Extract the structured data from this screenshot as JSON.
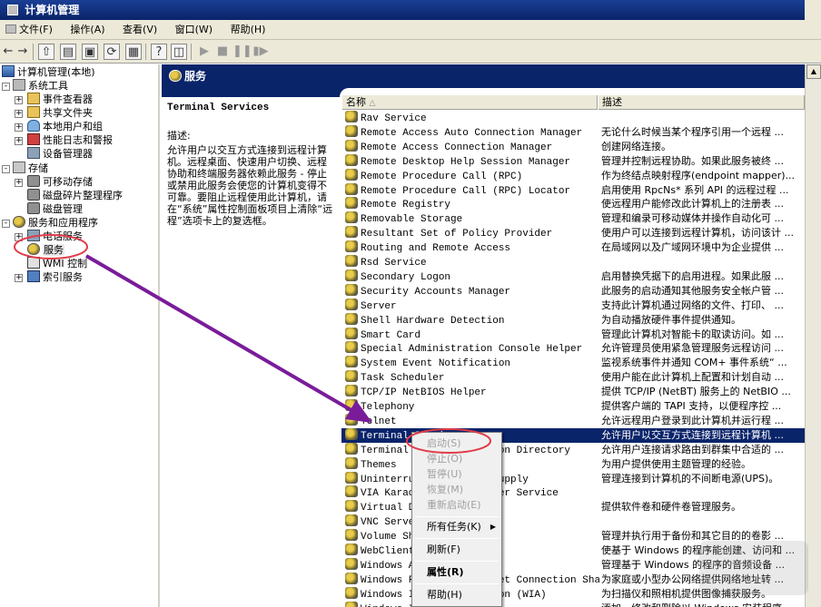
{
  "window": {
    "title": "计算机管理"
  },
  "menu": [
    "文件(F)",
    "操作(A)",
    "查看(V)",
    "窗口(W)",
    "帮助(H)"
  ],
  "tree": {
    "root": "计算机管理(本地)",
    "system_tools": "系统工具",
    "event_viewer": "事件查看器",
    "shared_folders": "共享文件夹",
    "local_users": "本地用户和组",
    "perf_logs": "性能日志和警报",
    "device_manager": "设备管理器",
    "storage": "存储",
    "removable_storage": "可移动存储",
    "defrag": "磁盘碎片整理程序",
    "disk_mgmt": "磁盘管理",
    "services_apps": "服务和应用程序",
    "telephony": "电话服务",
    "services": "服务",
    "wmi": "WMI 控制",
    "indexing": "索引服务"
  },
  "pane": {
    "header": "服务",
    "selected_service": "Terminal Services",
    "desc_label": "描述:",
    "desc_text": "允许用户以交互方式连接到远程计算机。远程桌面、快速用户切换、远程协助和终端服务器依赖此服务 - 停止或禁用此服务会使您的计算机变得不可靠。要阻止远程使用此计算机，请在“系统”属性控制面板项目上清除“远程”选项卡上的复选框。"
  },
  "list": {
    "col_name": "名称",
    "col_desc": "描述",
    "rows": [
      {
        "name": "Rav Service",
        "desc": ""
      },
      {
        "name": "Remote Access Auto Connection Manager",
        "desc": "无论什么时候当某个程序引用一个远程 ..."
      },
      {
        "name": "Remote Access Connection Manager",
        "desc": "创建网络连接。"
      },
      {
        "name": "Remote Desktop Help Session Manager",
        "desc": "管理并控制远程协助。如果此服务被终 ..."
      },
      {
        "name": "Remote Procedure Call (RPC)",
        "desc": "作为终结点映射程序(endpoint mapper)..."
      },
      {
        "name": "Remote Procedure Call (RPC) Locator",
        "desc": "启用使用 RpcNs* 系列 API 的远程过程 ..."
      },
      {
        "name": "Remote Registry",
        "desc": "使远程用户能修改此计算机上的注册表 ..."
      },
      {
        "name": "Removable Storage",
        "desc": "管理和编录可移动媒体并操作自动化可 ..."
      },
      {
        "name": "Resultant Set of Policy Provider",
        "desc": "使用户可以连接到远程计算机，访问该计 ..."
      },
      {
        "name": "Routing and Remote Access",
        "desc": "在局域网以及广域网环境中为企业提供 ..."
      },
      {
        "name": "Rsd Service",
        "desc": ""
      },
      {
        "name": "Secondary Logon",
        "desc": "启用替换凭据下的启用进程。如果此服 ..."
      },
      {
        "name": "Security Accounts Manager",
        "desc": "此服务的启动通知其他服务安全帐户管 ..."
      },
      {
        "name": "Server",
        "desc": "支持此计算机通过网络的文件、打印、 ..."
      },
      {
        "name": "Shell Hardware Detection",
        "desc": "为自动播放硬件事件提供通知。"
      },
      {
        "name": "Smart Card",
        "desc": "管理此计算机对智能卡的取读访问。如 ..."
      },
      {
        "name": "Special Administration Console Helper",
        "desc": "允许管理员使用紧急管理服务远程访问 ..."
      },
      {
        "name": "System Event Notification",
        "desc": "监视系统事件并通知 COM+ 事件系统“ ..."
      },
      {
        "name": "Task Scheduler",
        "desc": "使用户能在此计算机上配置和计划自动 ..."
      },
      {
        "name": "TCP/IP NetBIOS Helper",
        "desc": "提供 TCP/IP (NetBT) 服务上的 NetBIO ..."
      },
      {
        "name": "Telephony",
        "desc": "提供客户端的 TAPI 支持，以便程序控 ..."
      },
      {
        "name": "Telnet",
        "desc": "允许远程用户登录到此计算机并运行程 ..."
      },
      {
        "name": "Terminal Services",
        "desc": "允许用户以交互方式连接到远程计算机 ..."
      },
      {
        "name": "Terminal Services Session Directory",
        "desc": "允许用户连接请求路由到群集中合适的 ..."
      },
      {
        "name": "Themes",
        "desc": "为用户提供使用主题管理的经验。"
      },
      {
        "name": "Uninterruptible Power Supply",
        "desc": "管理连接到计算机的不间断电源(UPS)。"
      },
      {
        "name": "VIA Karaoke digital mixer Service",
        "desc": ""
      },
      {
        "name": "Virtual Disk Service",
        "desc": "提供软件卷和硬件卷管理服务。"
      },
      {
        "name": "VNC Server",
        "desc": ""
      },
      {
        "name": "Volume Shadow Copy",
        "desc": "管理并执行用于备份和其它目的的卷影 ..."
      },
      {
        "name": "WebClient",
        "desc": "使基于 Windows 的程序能创建、访问和 ..."
      },
      {
        "name": "Windows Audio",
        "desc": "管理基于 Windows 的程序的音频设备 ..."
      },
      {
        "name": "Windows Firewall/Internet Connection Sharing",
        "desc": "为家庭或小型办公网络提供网络地址转 ..."
      },
      {
        "name": "Windows Image Acquisition (WIA)",
        "desc": "为扫描仪和照相机提供图像捕获服务。"
      },
      {
        "name": "Windows Installer",
        "desc": "添加、修改和删除以 Windows 安装程序 ..."
      }
    ],
    "visible_names": [
      "Rav Service",
      "Remote Access Auto Connection Manager",
      "Remote Access Connection Manager",
      "Remote Desktop Help Session Manager",
      "Remote Procedure Call (RPC)",
      "Remote Procedure Call (RPC) Locator",
      "Remote Registry",
      "Removable Storage",
      "Resultant Set of Policy Provider",
      "Routing and Remote Access",
      "Rsd Service",
      "Secondary Logon",
      "Security Accounts Manager",
      "Server",
      "Shell Hardware Detection",
      "Smart Card",
      "Special Administration Console Helper",
      "System Event Notification",
      "Task Scheduler",
      "TCP/IP NetBIOS Helper",
      "Telephony",
      "Telnet",
      "Terminal S",
      "Terminal S",
      "Themes",
      "Uninterrup",
      "VIA Karaok",
      "Virtual Di",
      "VNC Server",
      "Volume Sha",
      "WebClient",
      "Windows Au",
      "Windows Fi",
      "Windows Im",
      "Windows In"
    ],
    "visible_tails": [
      "",
      "",
      "",
      "",
      "",
      "",
      "",
      "",
      "",
      "",
      "",
      "",
      "",
      "",
      "",
      "",
      "",
      "",
      "",
      "",
      "",
      "",
      "",
      "rectory",
      "",
      "",
      "rvice",
      "",
      "",
      "",
      "",
      "",
      "nnection Sharin...",
      "IA)",
      ""
    ]
  },
  "context_menu": {
    "start": "启动(S)",
    "stop": "停止(O)",
    "pause": "暂停(U)",
    "resume": "恢复(M)",
    "restart": "重新启动(E)",
    "all_tasks": "所有任务(K)",
    "refresh": "刷新(F)",
    "properties": "属性(R)",
    "help": "帮助(H)"
  },
  "colors": {
    "selection": "#0a246a",
    "annotation_ellipse": "#e03c4a",
    "arrow": "#7a1c9a"
  }
}
